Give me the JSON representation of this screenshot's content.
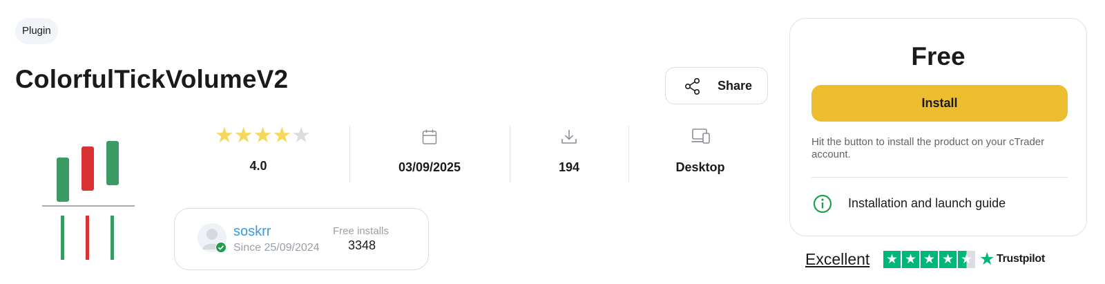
{
  "product": {
    "category": "Plugin",
    "title": "ColorfulTickVolumeV2"
  },
  "share": {
    "label": "Share",
    "icon": "share-icon"
  },
  "stats": {
    "rating": {
      "value": "4.0",
      "stars": 4,
      "max": 5
    },
    "date": {
      "value": "03/09/2025",
      "icon": "calendar-icon"
    },
    "downloads": {
      "value": "194",
      "icon": "download-icon"
    },
    "platform": {
      "value": "Desktop",
      "icon": "devices-icon"
    }
  },
  "author": {
    "name": "soskrr",
    "since": "Since 25/09/2024",
    "free_installs_label": "Free installs",
    "free_installs_value": "3348"
  },
  "purchase": {
    "price": "Free",
    "install_label": "Install",
    "hint": "Hit the button to install the product on your cTrader account.",
    "guide_label": "Installation and launch guide"
  },
  "trustpilot": {
    "rating_word": "Excellent",
    "brand": "Trustpilot",
    "stars": 4.5
  },
  "colors": {
    "install": "#ebbd2f",
    "author_link": "#3a9be0",
    "rating_star": "#f5d75a",
    "logo_green": "#3c9a65",
    "logo_red": "#d83232",
    "trustpilot_green": "#00b67a"
  }
}
